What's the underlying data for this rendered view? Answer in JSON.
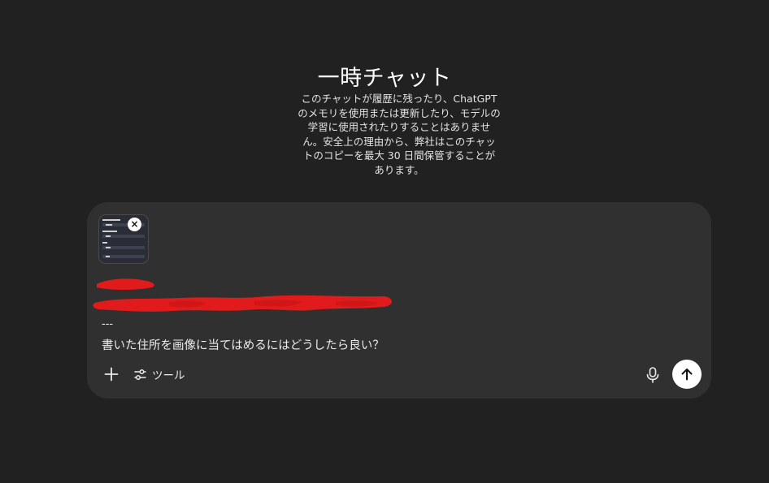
{
  "header": {
    "title": "一時チャット",
    "description_lines": [
      "このチャットが履歴に残ったり、ChatGPT",
      "のメモリを使用または更新したり、モデルの",
      "学習に使用されたりすることはありませ",
      "ん。安全上の理由から、弊社はこのチャッ",
      "トのコピーを最大 30 日間保管することが",
      "あります。"
    ]
  },
  "composer": {
    "attachment_remove_symbol": "×",
    "message_separator": "---",
    "message_text": "書いた住所を画像に当てはめるにはどうしたら良い？",
    "tools_label": "ツール",
    "redaction_color": "#e11b1b"
  },
  "icons": {
    "add": "plus-icon",
    "tools": "sliders-icon",
    "mic": "microphone-icon",
    "send": "arrow-up-icon"
  }
}
